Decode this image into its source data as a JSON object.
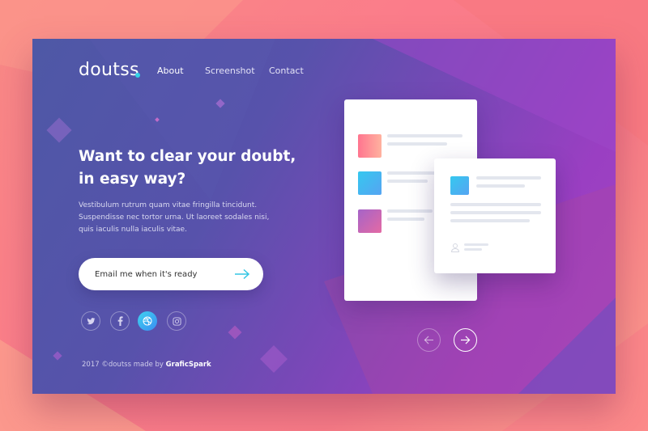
{
  "brand": {
    "name": "doutss",
    "dot_color": "#33d1e6"
  },
  "nav": [
    {
      "label": "About",
      "active": true
    },
    {
      "label": "Screenshot",
      "active": false
    },
    {
      "label": "Contact",
      "active": false
    }
  ],
  "hero": {
    "headline_line1": "Want to clear your doubt,",
    "headline_line2": "in easy way?",
    "body_line1": "Vestibulum rutrum quam vitae fringilla tincidunt.",
    "body_line2": "Suspendisse nec tortor urna. Ut laoreet sodales nisi,",
    "body_line3": "quis iaculis nulla iaculis vitae."
  },
  "cta": {
    "label": "Email me when it's ready",
    "icon": "arrow-right-icon",
    "accent": "#33c6e4"
  },
  "social": [
    {
      "icon": "twitter-icon",
      "active": false
    },
    {
      "icon": "facebook-icon",
      "active": false
    },
    {
      "icon": "dribbble-icon",
      "active": true
    },
    {
      "icon": "instagram-icon",
      "active": false
    }
  ],
  "footer": {
    "prefix": "2017 ©doutss made by ",
    "author": "GraficSpark"
  },
  "slider": {
    "prev_icon": "arrow-left-icon",
    "next_icon": "arrow-right-icon"
  },
  "colors": {
    "card_red": [
      "#ff7a8e",
      "#ffb6a0"
    ],
    "card_blue": [
      "#35c8ef",
      "#58a6f2"
    ],
    "card_purple": [
      "#b163c5",
      "#e26aa6"
    ]
  }
}
